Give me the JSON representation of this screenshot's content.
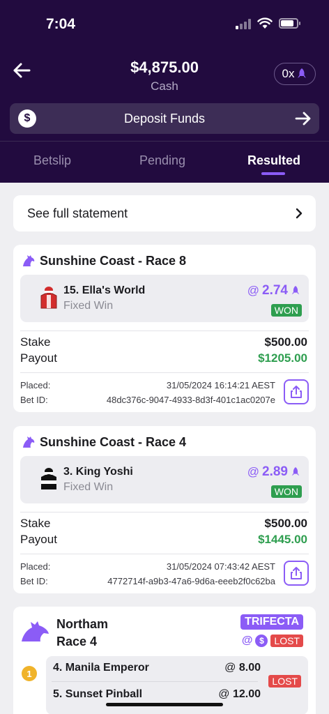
{
  "status_bar": {
    "time": "7:04"
  },
  "header": {
    "balance": "$4,875.00",
    "balance_label": "Cash",
    "multiplier": "0x",
    "deposit_label": "Deposit Funds"
  },
  "tabs": [
    {
      "label": "Betslip",
      "active": false
    },
    {
      "label": "Pending",
      "active": false
    },
    {
      "label": "Resulted",
      "active": true
    }
  ],
  "statement": {
    "label": "See full statement"
  },
  "bets": [
    {
      "race": "Sunshine Coast - Race 8",
      "runner": "15. Ella's World",
      "bet_type": "Fixed Win",
      "odds_prefix": "@",
      "odds": "2.74",
      "result": "WON",
      "stake_label": "Stake",
      "stake": "$500.00",
      "payout_label": "Payout",
      "payout": "$1205.00",
      "placed_label": "Placed:",
      "placed": "31/05/2024 16:14:21 AEST",
      "bet_id_label": "Bet ID:",
      "bet_id": "48dc376c-9047-4933-8d3f-401c1ac0207e",
      "silk_colors": [
        "#d22d2d",
        "#ffffff"
      ]
    },
    {
      "race": "Sunshine Coast - Race 4",
      "runner": "3. King Yoshi",
      "bet_type": "Fixed Win",
      "odds_prefix": "@",
      "odds": "2.89",
      "result": "WON",
      "stake_label": "Stake",
      "stake": "$500.00",
      "payout_label": "Payout",
      "payout": "$1445.00",
      "placed_label": "Placed:",
      "placed": "31/05/2024 07:43:42 AEST",
      "bet_id_label": "Bet ID:",
      "bet_id": "4772714f-a9b3-47a6-9d6a-eeeb2f0c62ba",
      "silk_colors": [
        "#111111",
        "#ffffff"
      ]
    }
  ],
  "exotic_bet": {
    "title_line1": "Northam",
    "title_line2": "Race 4",
    "type_badge": "TRIFECTA",
    "at_sign": "@",
    "coin_symbol": "$",
    "result": "LOST",
    "position": "1",
    "runners": [
      {
        "name": "4. Manila Emperor",
        "odds_prefix": "@",
        "odds": "8.00"
      },
      {
        "name": "5. Sunset Pinball",
        "odds_prefix": "@",
        "odds": "12.00"
      }
    ],
    "runners_result": "LOST"
  },
  "colors": {
    "header_bg": "#220b3f",
    "accent": "#8b5cf6",
    "won": "#2e9e4f",
    "lost": "#e44a4a"
  },
  "icons": [
    "back-arrow-icon",
    "rocket-icon",
    "dollar-icon",
    "forward-arrow-icon",
    "chevron-right-icon",
    "horse-icon",
    "jockey-silk-icon",
    "share-icon",
    "coin-icon"
  ]
}
